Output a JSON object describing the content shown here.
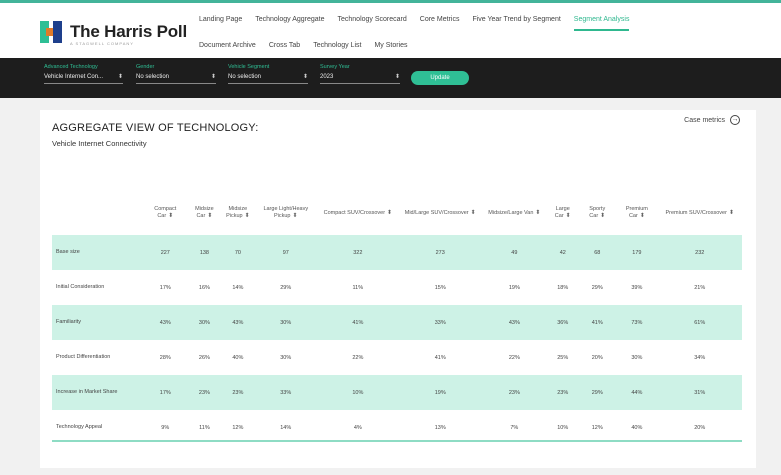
{
  "app": {
    "logo_text": "The Harris Poll",
    "logo_tagline": "A STAGWELL COMPANY"
  },
  "nav": {
    "row1": [
      {
        "label": "Landing Page",
        "active": false
      },
      {
        "label": "Technology Aggregate",
        "active": false
      },
      {
        "label": "Technology Scorecard",
        "active": false
      },
      {
        "label": "Core Metrics",
        "active": false
      },
      {
        "label": "Five Year Trend by Segment",
        "active": false
      },
      {
        "label": "Segment Analysis",
        "active": true
      }
    ],
    "row2": [
      {
        "label": "Document Archive",
        "active": false
      },
      {
        "label": "Cross Tab",
        "active": false
      },
      {
        "label": "Technology List",
        "active": false
      },
      {
        "label": "My Stories",
        "active": false
      }
    ]
  },
  "filters": [
    {
      "label": "Advanced Technology",
      "value": "Vehicle Internet Con..."
    },
    {
      "label": "Gender",
      "value": "No selection"
    },
    {
      "label": "Vehicle Segment",
      "value": "No selection"
    },
    {
      "label": "Survey Year",
      "value": "2023"
    }
  ],
  "update_label": "Update",
  "card": {
    "title": "AGGREGATE VIEW OF TECHNOLOGY:",
    "subtitle": "Vehicle Internet Connectivity",
    "case_metrics_label": "Case metrics"
  },
  "table": {
    "columns": [
      "",
      "Compact Car",
      "Midsize Car",
      "Midsize Pickup",
      "Large Light/Heavy Pickup",
      "Compact SUV/Crossover",
      "Mid/Large SUV/Crossover",
      "Midsize/Large Van",
      "Large Car",
      "Sporty Car",
      "Premium Car",
      "Premium SUV/Crossover"
    ],
    "rows": [
      {
        "label": "Base size",
        "band": true,
        "values": [
          "227",
          "138",
          "70",
          "97",
          "322",
          "273",
          "49",
          "42",
          "68",
          "179",
          "232"
        ]
      },
      {
        "label": "Initial Consideration",
        "band": false,
        "values": [
          "17%",
          "16%",
          "14%",
          "29%",
          "11%",
          "15%",
          "19%",
          "18%",
          "29%",
          "39%",
          "21%"
        ]
      },
      {
        "label": "Familiarity",
        "band": true,
        "values": [
          "43%",
          "30%",
          "43%",
          "30%",
          "41%",
          "33%",
          "43%",
          "36%",
          "41%",
          "73%",
          "61%"
        ]
      },
      {
        "label": "Product Differentiation",
        "band": false,
        "values": [
          "28%",
          "26%",
          "40%",
          "30%",
          "22%",
          "41%",
          "22%",
          "25%",
          "20%",
          "30%",
          "34%"
        ]
      },
      {
        "label": "Increase in Market Share",
        "band": true,
        "values": [
          "17%",
          "23%",
          "23%",
          "33%",
          "10%",
          "19%",
          "23%",
          "23%",
          "29%",
          "44%",
          "31%"
        ]
      },
      {
        "label": "Technology Appeal",
        "band": false,
        "values": [
          "9%",
          "11%",
          "12%",
          "14%",
          "4%",
          "13%",
          "7%",
          "10%",
          "12%",
          "40%",
          "20%"
        ]
      }
    ]
  },
  "colors": {
    "accent": "#2fbf95",
    "band": "#cdf2e6",
    "filterbar": "#1d1d1d"
  }
}
